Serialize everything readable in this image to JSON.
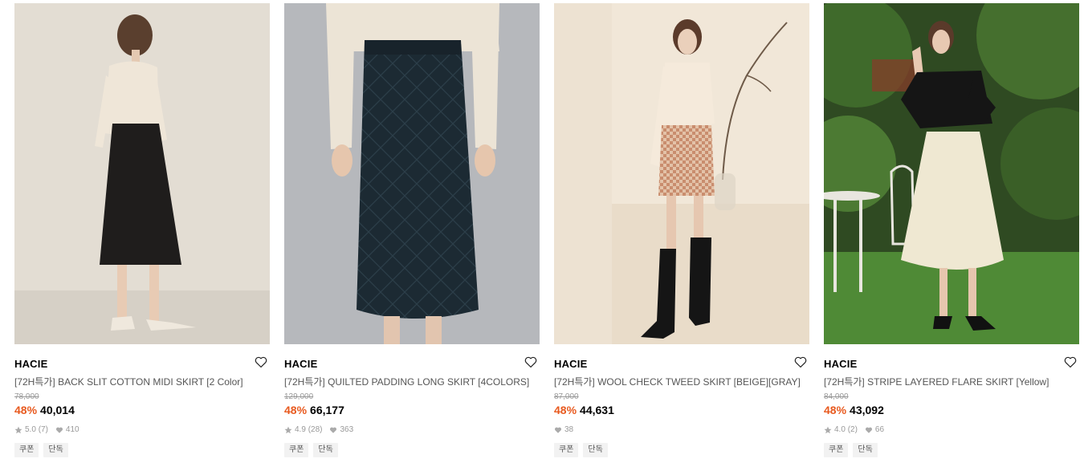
{
  "colors": {
    "discount": "#e85a1f",
    "meta": "#999999",
    "tag_bg": "#f2f2f2"
  },
  "products": [
    {
      "brand": "HACIE",
      "title": "[72H특가] BACK SLIT COTTON MIDI SKIRT [2 Color]",
      "original_price": "78,000",
      "discount": "48%",
      "price": "40,014",
      "rating": "5.0",
      "reviews": "(7)",
      "likes": "410",
      "tags": [
        "쿠폰",
        "단독"
      ]
    },
    {
      "brand": "HACIE",
      "title": "[72H특가] QUILTED PADDING LONG SKIRT [4COLORS]",
      "original_price": "129,000",
      "discount": "48%",
      "price": "66,177",
      "rating": "4.9",
      "reviews": "(28)",
      "likes": "363",
      "tags": [
        "쿠폰",
        "단독"
      ]
    },
    {
      "brand": "HACIE",
      "title": "[72H특가] WOOL CHECK TWEED SKIRT [BEIGE][GRAY]",
      "original_price": "87,000",
      "discount": "48%",
      "price": "44,631",
      "likes": "38",
      "tags": [
        "쿠폰",
        "단독"
      ]
    },
    {
      "brand": "HACIE",
      "title": "[72H특가] STRIPE LAYERED FLARE SKIRT [Yellow]",
      "original_price": "84,000",
      "discount": "48%",
      "price": "43,092",
      "rating": "4.0",
      "reviews": "(2)",
      "likes": "66",
      "tags": [
        "쿠폰",
        "단독"
      ]
    }
  ]
}
